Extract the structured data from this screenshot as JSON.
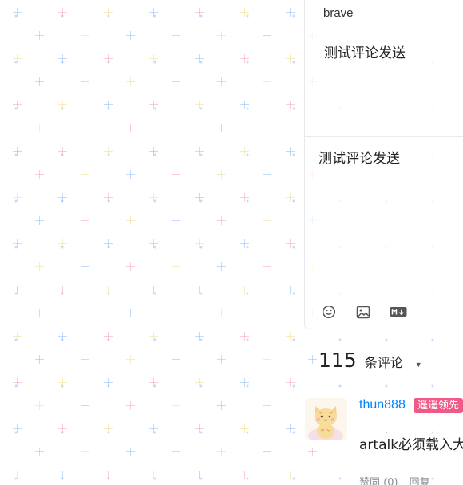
{
  "editor": {
    "name_value": "brave",
    "preview_text": "测试评论发送",
    "content_value": "测试评论发送",
    "tools": [
      {
        "icon": "emoji-icon"
      },
      {
        "icon": "image-icon"
      },
      {
        "icon": "markdown-icon"
      }
    ]
  },
  "comments": {
    "count": "115",
    "count_label": "条评论",
    "sort_icon": "caret-down-icon",
    "items": [
      {
        "nick": "thun888",
        "badge": "遥遥领先",
        "content": "artalk必须载入大",
        "vote_label": "赞同 (0)",
        "reply_label": "回复",
        "badge_color": "#f05a87",
        "nick_color": "#0083ff"
      }
    ]
  }
}
